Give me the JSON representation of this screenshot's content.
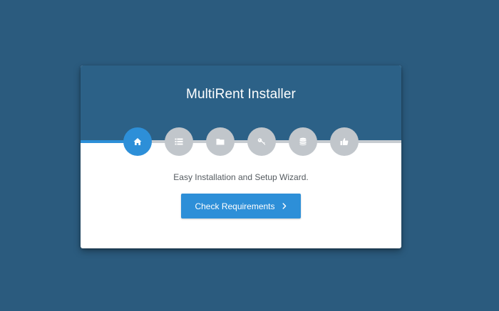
{
  "installer": {
    "title": "MultiRent Installer",
    "subtitle": "Easy Installation and Setup Wizard.",
    "button_label": "Check Requirements",
    "button_icon": "chevron-right-icon",
    "current_step": 1,
    "total_steps": 6,
    "progress_fraction": 0.17,
    "steps": [
      {
        "icon": "home-icon",
        "active": true
      },
      {
        "icon": "list-icon",
        "active": false
      },
      {
        "icon": "folder-icon",
        "active": false
      },
      {
        "icon": "key-icon",
        "active": false
      },
      {
        "icon": "database-icon",
        "active": false
      },
      {
        "icon": "thumbs-up-icon",
        "active": false
      }
    ]
  },
  "colors": {
    "page_background": "#2b5b7e",
    "header_background": "#2c6187",
    "accent": "#2d8fd8",
    "inactive_step": "#c1c6cb",
    "card_background": "#ffffff"
  }
}
